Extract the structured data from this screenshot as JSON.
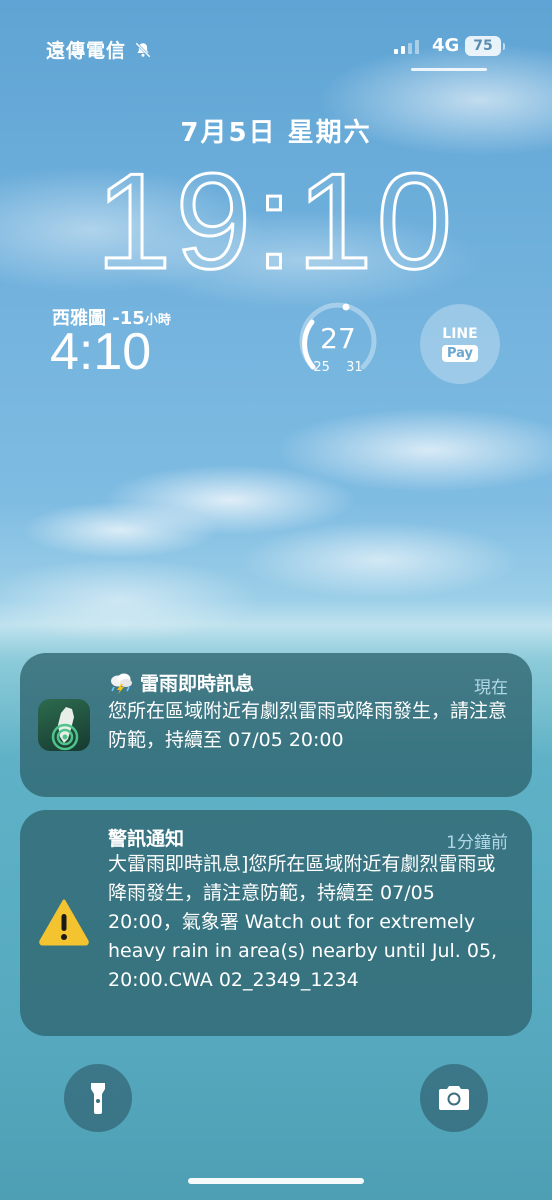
{
  "status_bar": {
    "carrier": "遠傳電信",
    "network": "4G",
    "battery": "75",
    "mute_icon": "bell-slash-icon"
  },
  "lock_screen": {
    "date": "7月5日 星期六",
    "time": "19:10"
  },
  "widgets": {
    "world_clock": {
      "city": "西雅圖",
      "offset": "-15",
      "offset_unit": "小時",
      "time": "4:10"
    },
    "weather": {
      "temperature": "27",
      "low": "25",
      "high": "31"
    },
    "linepay": {
      "line_label": "LINE",
      "pay_label": "Pay"
    }
  },
  "notifications": [
    {
      "title": "雷雨即時訊息",
      "time": "現在",
      "body": "您所在區域附近有劇烈雷雨或降雨發生，請注意防範，持續至 07/05 20:00",
      "icon": "weather-radar-app-icon",
      "title_icon": "thunderstorm-icon"
    },
    {
      "title": "警訊通知",
      "time": "1分鐘前",
      "body": "大雷雨即時訊息]您所在區域附近有劇烈雷雨或降雨發生，請注意防範，持續至 07/05 20:00，氣象署 Watch out for extremely heavy rain in area(s) nearby until Jul. 05, 20:00.CWA 02_2349_1234",
      "icon": "warning-icon"
    }
  ],
  "quick_actions": {
    "left": "flashlight-icon",
    "right": "camera-icon"
  },
  "colors": {
    "notification_bg": "#2e646e",
    "warning_yellow": "#f4c430",
    "sky_top": "#5fa4d4",
    "sea": "#5aaec3"
  }
}
